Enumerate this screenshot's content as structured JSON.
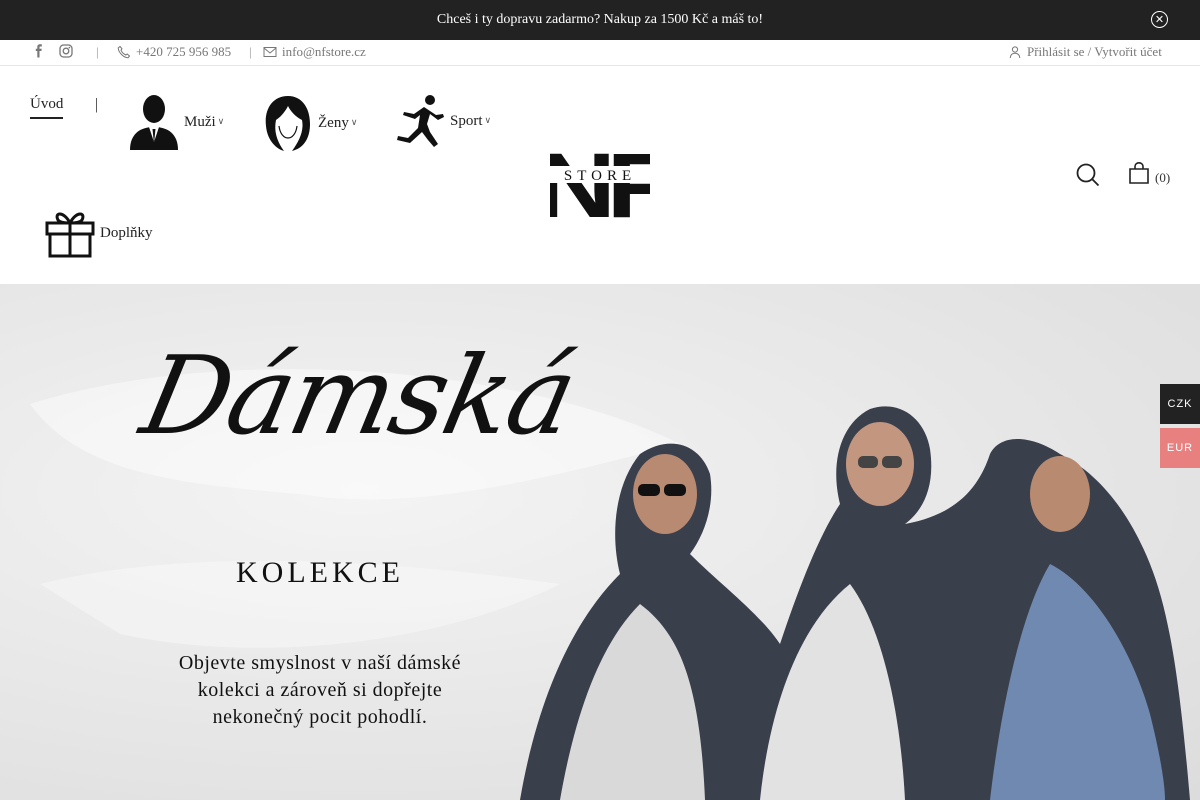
{
  "announcement": {
    "text": "Chceš i ty dopravu zadarmo? Nakup za 1500 Kč a máš to!",
    "close_icon": "close-circle-icon"
  },
  "contact": {
    "phone": "+420 725 956 985",
    "email": "info@nfstore.cz",
    "social": [
      "facebook-icon",
      "instagram-icon"
    ],
    "account": "Přihlásit se / Vytvořit účet"
  },
  "nav": {
    "home": "Úvod",
    "separator": "|",
    "items": [
      {
        "label": "Muži",
        "icon": "man-icon"
      },
      {
        "label": "Ženy",
        "icon": "woman-icon"
      },
      {
        "label": "Sport",
        "icon": "runner-icon"
      },
      {
        "label": "Doplňky",
        "icon": "gift-icon"
      }
    ]
  },
  "logo": {
    "letters": "NF",
    "word": "STORE"
  },
  "cart": {
    "count": "(0)"
  },
  "hero": {
    "script_title": "Dámská",
    "subtitle": "KOLEKCE",
    "lines": [
      "Objevte smyslnost v naší dámské",
      "kolekci a zároveň si dopřejte",
      "nekonečný pocit pohodlí."
    ]
  },
  "currency": {
    "options": [
      {
        "code": "CZK",
        "color": "#222222"
      },
      {
        "code": "EUR",
        "color": "#e88080"
      }
    ]
  },
  "colors": {
    "dark": "#222222",
    "accent": "#e88080"
  }
}
